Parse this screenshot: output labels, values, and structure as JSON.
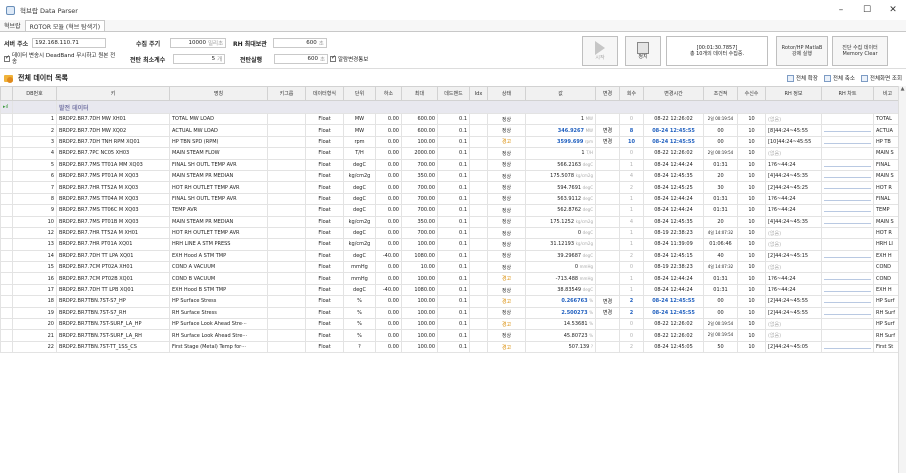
{
  "window": {
    "title": "혁브랍 Data Parser",
    "controls": [
      "–",
      "☐",
      "✕"
    ]
  },
  "menu": {
    "tabs": [
      "혁브랍",
      "ROTOR 모듈 (혁브 탐색기)"
    ]
  },
  "config": {
    "server_label": "서버 주소",
    "server_value": "192.168.110.71",
    "period_label": "수집 주기",
    "period_value": "10000",
    "period_unit": "밀리초",
    "rh_max_label": "RH 최대보관",
    "rh_max_value": "600",
    "rh_max_unit": "초",
    "deadband_check": "데이터 변송시 DeadBand 무시하고 원본 전송",
    "wait_label": "전탄 최소계수",
    "wait_value": "5",
    "wait_unit": "개",
    "delay_label": "전탄실행",
    "delay_value": "600",
    "delay_unit": "초",
    "alarm_check": "알람변경통보"
  },
  "buttons": {
    "start": "시작",
    "stop": "정지",
    "status_line1": "[00:01:30.7857]",
    "status_line2": "총 10개의 데이터 수집중.",
    "rotor_line1": "Rotor/HP MatlaB",
    "rotor_line2": "강제 실행",
    "memory_line1": "진단 수집 데이터",
    "memory_line2": "Memory Clear"
  },
  "section": {
    "title": "전체 데이터 목록",
    "expand_all": "전체 확장",
    "collapse_all": "전체 축소",
    "full_view": "전체화면 조회"
  },
  "table": {
    "columns": [
      "DB번호",
      "키",
      "명칭",
      "키그룹",
      "데이터형식",
      "단위",
      "하소",
      "최대",
      "데드밴드",
      "Idx",
      "상태",
      "값",
      "변경",
      "회수",
      "변경시간",
      "조건적",
      "수신수",
      "RH 정보",
      "RH 차트",
      "비고"
    ],
    "group_label": "발전 데이터",
    "rows": [
      {
        "no": "1",
        "key": "BRDP2.BR7.7DH MW XH01",
        "name": "TOTAL MW LOAD",
        "type": "Float",
        "unit": "MW",
        "min": "0.00",
        "max": "600.00",
        "db": "0.1",
        "st": "정상",
        "sc": "ok",
        "val": "1",
        "vu": "MW",
        "vb": false,
        "chg": "",
        "cnt": "0",
        "time": "08-22 12:26:02",
        "tb": false,
        "cond": "2일 00:19:54",
        "recv": "10",
        "rh": "(없음)",
        "note": "TOTAL"
      },
      {
        "no": "2",
        "key": "BRDP2.BR7.7DH MW XQ02",
        "name": "ACTUAL MW LOAD",
        "type": "Float",
        "unit": "MW",
        "min": "0.00",
        "max": "600.00",
        "db": "0.1",
        "st": "정상",
        "sc": "ok",
        "val": "346.9267",
        "vu": "MW",
        "vb": true,
        "chg": "변경",
        "cnt": "8",
        "time": "08-24 12:45:55",
        "tb": true,
        "cond": "00",
        "recv": "10",
        "rh": "[8]44:24~45:55",
        "note": "ACTUA"
      },
      {
        "no": "3",
        "key": "BRDP2.BR7.7DH TNH RPM XQ01",
        "name": "HP TBN SPD (RPM)",
        "type": "Float",
        "unit": "rpm",
        "min": "0.00",
        "max": "100.00",
        "db": "0.1",
        "st": "경고",
        "sc": "warn",
        "val": "3599.699",
        "vu": "rpm",
        "vb": true,
        "chg": "변경",
        "cnt": "10",
        "time": "08-24 12:45:55",
        "tb": true,
        "cond": "00",
        "recv": "10",
        "rh": "[10]44:24~45:55",
        "note": "HP TB"
      },
      {
        "no": "4",
        "key": "BRDP2.BR7.7PC NC05 XH03",
        "name": "MAIN STEAM FLOW",
        "type": "Float",
        "unit": "T/H",
        "min": "0.00",
        "max": "2000.00",
        "db": "0.1",
        "st": "정상",
        "sc": "ok",
        "val": "1",
        "vu": "T/H",
        "vb": false,
        "chg": "",
        "cnt": "0",
        "time": "08-22 12:26:02",
        "tb": false,
        "cond": "2일 00:19:54",
        "recv": "10",
        "rh": "(없음)",
        "note": "MAIN S"
      },
      {
        "no": "5",
        "key": "BRDP2.BR7.7MS TT01A MM XQ03",
        "name": "FINAL SH OUTL TEMP AVR",
        "type": "Float",
        "unit": "degC",
        "min": "0.00",
        "max": "700.00",
        "db": "0.1",
        "st": "정상",
        "sc": "ok",
        "val": "566.2163",
        "vu": "degC",
        "vb": false,
        "chg": "",
        "cnt": "1",
        "time": "08-24 12:44:24",
        "tb": false,
        "cond": "01:31",
        "recv": "10",
        "rh": "1?6~44:24",
        "note": "FINAL"
      },
      {
        "no": "6",
        "key": "BRDP2.BR7.7MS PT01A M XQ03",
        "name": "MAIN STEAM PR MEDIAN",
        "type": "Float",
        "unit": "kg/cm2g",
        "min": "0.00",
        "max": "350.00",
        "db": "0.1",
        "st": "정상",
        "sc": "ok",
        "val": "175.5078",
        "vu": "kg/cm2g",
        "vb": false,
        "chg": "",
        "cnt": "4",
        "time": "08-24 12:45:35",
        "tb": false,
        "cond": "20",
        "recv": "10",
        "rh": "[4]44:24~45:35",
        "note": "MAIN S"
      },
      {
        "no": "7",
        "key": "BRDP2.BR7.7HR TT52A M XQ03",
        "name": "HOT RH OUTLET TEMP AVR",
        "type": "Float",
        "unit": "degC",
        "min": "0.00",
        "max": "700.00",
        "db": "0.1",
        "st": "정상",
        "sc": "ok",
        "val": "594.7691",
        "vu": "degC",
        "vb": false,
        "chg": "",
        "cnt": "2",
        "time": "08-24 12:45:25",
        "tb": false,
        "cond": "30",
        "recv": "10",
        "rh": "[2]44:24~45:25",
        "note": "HOT R"
      },
      {
        "no": "8",
        "key": "BRDP2.BR7.7MS TT04A M XQ03",
        "name": "FINAL SH OUTL TEMP AVR",
        "type": "Float",
        "unit": "degC",
        "min": "0.00",
        "max": "700.00",
        "db": "0.1",
        "st": "정상",
        "sc": "ok",
        "val": "563.9112",
        "vu": "degC",
        "vb": false,
        "chg": "",
        "cnt": "1",
        "time": "08-24 12:44:24",
        "tb": false,
        "cond": "01:31",
        "recv": "10",
        "rh": "1?6~44:24",
        "note": "FINAL"
      },
      {
        "no": "9",
        "key": "BRDP2.BR7.7MS TT06C M XQ03",
        "name": "TEMP AVR",
        "type": "Float",
        "unit": "degC",
        "min": "0.00",
        "max": "700.00",
        "db": "0.1",
        "st": "정상",
        "sc": "ok",
        "val": "562.8762",
        "vu": "degC",
        "vb": false,
        "chg": "",
        "cnt": "1",
        "time": "08-24 12:44:24",
        "tb": false,
        "cond": "01:31",
        "recv": "10",
        "rh": "1?6~44:24",
        "note": "TEMP"
      },
      {
        "no": "10",
        "key": "BRDP2.BR7.7MS PT01B M XQ03",
        "name": "MAIN STEAM PR MEDIAN",
        "type": "Float",
        "unit": "kg/cm2g",
        "min": "0.00",
        "max": "350.00",
        "db": "0.1",
        "st": "정상",
        "sc": "ok",
        "val": "175.1252",
        "vu": "kg/cm2g",
        "vb": false,
        "chg": "",
        "cnt": "4",
        "time": "08-24 12:45:35",
        "tb": false,
        "cond": "20",
        "recv": "10",
        "rh": "[4]44:24~45:35",
        "note": "MAIN S"
      },
      {
        "no": "12",
        "key": "BRDP2.BR7.7HR TT52A M XH01",
        "name": "HOT RH OUTLET TEMP AVR",
        "type": "Float",
        "unit": "degC",
        "min": "0.00",
        "max": "700.00",
        "db": "0.1",
        "st": "정상",
        "sc": "ok",
        "val": "0",
        "vu": "degC",
        "vb": false,
        "chg": "",
        "cnt": "1",
        "time": "08-19 22:38:23",
        "tb": false,
        "cond": "4일 14:07:32",
        "recv": "10",
        "rh": "(없음)",
        "note": "HOT R"
      },
      {
        "no": "13",
        "key": "BRDP2.BR7.7HR PT01A XQ01",
        "name": "HRH LINE A STM PRESS",
        "type": "Float",
        "unit": "kg/cm2g",
        "min": "0.00",
        "max": "100.00",
        "db": "0.1",
        "st": "정상",
        "sc": "ok",
        "val": "31.12193",
        "vu": "kg/cm2g",
        "vb": false,
        "chg": "",
        "cnt": "1",
        "time": "08-24 11:39:09",
        "tb": false,
        "cond": "01:06:46",
        "recv": "10",
        "rh": "(없음)",
        "note": "HRH LI"
      },
      {
        "no": "14",
        "key": "BRDP2.BR7.7DH TT LPA XQ01",
        "name": "EXH Hood A STM TMP",
        "type": "Float",
        "unit": "degC",
        "min": "-40.00",
        "max": "1080.00",
        "db": "0.1",
        "st": "정상",
        "sc": "ok",
        "val": "39.29687",
        "vu": "degC",
        "vb": false,
        "chg": "",
        "cnt": "2",
        "time": "08-24 12:45:15",
        "tb": false,
        "cond": "40",
        "recv": "10",
        "rh": "[2]44:24~45:15",
        "note": "EXH H"
      },
      {
        "no": "15",
        "key": "BRDP2.BR7.7CM PT02A XH01",
        "name": "COND A VACUUM",
        "type": "Float",
        "unit": "mmHg",
        "min": "0.00",
        "max": "10.00",
        "db": "0.1",
        "st": "정상",
        "sc": "ok",
        "val": "0",
        "vu": "mmHg",
        "vb": false,
        "chg": "",
        "cnt": "0",
        "time": "08-19 22:38:23",
        "tb": false,
        "cond": "4일 14:07:32",
        "recv": "10",
        "rh": "(없음)",
        "note": "COND"
      },
      {
        "no": "16",
        "key": "BRDP2.BR7.7CM PT02B XQ01",
        "name": "COND B VACUUM",
        "type": "Float",
        "unit": "mmHg",
        "min": "0.00",
        "max": "100.00",
        "db": "0.1",
        "st": "경고",
        "sc": "warn",
        "val": "-713.488",
        "vu": "mmHg",
        "vb": false,
        "chg": "",
        "cnt": "1",
        "time": "08-24 12:44:24",
        "tb": false,
        "cond": "01:31",
        "recv": "10",
        "rh": "1?6~44:24",
        "note": "COND"
      },
      {
        "no": "17",
        "key": "BRDP2.BR7.7DH TT LPB XQ01",
        "name": "EXH Hood B STM TMP",
        "type": "Float",
        "unit": "degC",
        "min": "-40.00",
        "max": "1080.00",
        "db": "0.1",
        "st": "정상",
        "sc": "ok",
        "val": "38.83549",
        "vu": "degC",
        "vb": false,
        "chg": "",
        "cnt": "1",
        "time": "08-24 12:44:24",
        "tb": false,
        "cond": "01:31",
        "recv": "10",
        "rh": "1?6~44:24",
        "note": "EXH H"
      },
      {
        "no": "18",
        "key": "BRDP2.BR7TBN.7ST-S7_HP",
        "name": "HP Surface Stress",
        "type": "Float",
        "unit": "%",
        "min": "0.00",
        "max": "100.00",
        "db": "0.1",
        "st": "경고",
        "sc": "warn",
        "val": "0.266763",
        "vu": "%",
        "vb": true,
        "chg": "변경",
        "cnt": "2",
        "time": "08-24 12:45:55",
        "tb": true,
        "cond": "00",
        "recv": "10",
        "rh": "[2]44:24~45:55",
        "note": "HP Surf"
      },
      {
        "no": "19",
        "key": "BRDP2.BR7TBN.7ST-S7_RH",
        "name": "RH Surface Stress",
        "type": "Float",
        "unit": "%",
        "min": "0.00",
        "max": "100.00",
        "db": "0.1",
        "st": "정상",
        "sc": "ok",
        "val": "2.500273",
        "vu": "%",
        "vb": true,
        "chg": "변경",
        "cnt": "2",
        "time": "08-24 12:45:55",
        "tb": true,
        "cond": "00",
        "recv": "10",
        "rh": "[2]44:24~45:55",
        "note": "RH Surf"
      },
      {
        "no": "20",
        "key": "BRDP2.BR7TBN.7ST-SURF_LA_HP",
        "name": "HP Surface Look Ahead Stre···",
        "type": "Float",
        "unit": "%",
        "min": "0.00",
        "max": "100.00",
        "db": "0.1",
        "st": "경고",
        "sc": "warn",
        "val": "14.53681",
        "vu": "%",
        "vb": false,
        "chg": "",
        "cnt": "0",
        "time": "08-22 12:26:02",
        "tb": false,
        "cond": "2일 00:19:54",
        "recv": "10",
        "rh": "(없음)",
        "note": "HP Surf"
      },
      {
        "no": "21",
        "key": "BRDP2.BR7TBN.7ST-SURF_LA_RH",
        "name": "RH Surface Look Ahead Stre···",
        "type": "Float",
        "unit": "%",
        "min": "0.00",
        "max": "100.00",
        "db": "0.1",
        "st": "정상",
        "sc": "ok",
        "val": "45.80723",
        "vu": "%",
        "vb": false,
        "chg": "",
        "cnt": "0",
        "time": "08-22 12:26:02",
        "tb": false,
        "cond": "2일 00:19:54",
        "recv": "10",
        "rh": "(없음)",
        "note": "RH Surf"
      },
      {
        "no": "22",
        "key": "BRDP2.BR7TBN.7ST-TT_1SS_CS",
        "name": "First Stage (Metal) Temp for···",
        "type": "Float",
        "unit": "?",
        "min": "0.00",
        "max": "100.00",
        "db": "0.1",
        "st": "경고",
        "sc": "warn",
        "val": "507.139",
        "vu": "?",
        "vb": false,
        "chg": "",
        "cnt": "2",
        "time": "08-24 12:45:05",
        "tb": false,
        "cond": "50",
        "recv": "10",
        "rh": "[2]44:24~45:05",
        "note": "First St"
      }
    ]
  }
}
